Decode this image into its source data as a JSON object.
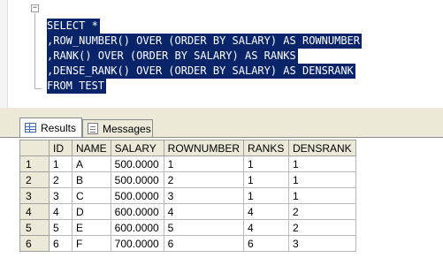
{
  "editor": {
    "lines": [
      "SELECT *",
      ",ROW_NUMBER() OVER (ORDER BY SALARY) AS ROWNUMBER",
      ",RANK() OVER (ORDER BY SALARY) AS RANKS",
      ",DENSE_RANK() OVER (ORDER BY SALARY) AS DENSRANK",
      "FROM TEST"
    ],
    "collapse_glyph": "−",
    "selection_color": "#0a246a"
  },
  "tabs": [
    {
      "label": "Results",
      "icon": "grid-icon",
      "active": true
    },
    {
      "label": "Messages",
      "icon": "message-icon",
      "active": false
    }
  ],
  "grid": {
    "columns": [
      "ID",
      "NAME",
      "SALARY",
      "ROWNUMBER",
      "RANKS",
      "DENSRANK"
    ],
    "row_numbers": [
      "1",
      "2",
      "3",
      "4",
      "5",
      "6"
    ],
    "rows": [
      [
        "1",
        "A",
        "500.0000",
        "1",
        "1",
        "1"
      ],
      [
        "2",
        "B",
        "500.0000",
        "2",
        "1",
        "1"
      ],
      [
        "3",
        "C",
        "500.0000",
        "3",
        "1",
        "1"
      ],
      [
        "4",
        "D",
        "600.0000",
        "4",
        "4",
        "2"
      ],
      [
        "5",
        "E",
        "600.0000",
        "5",
        "4",
        "2"
      ],
      [
        "6",
        "F",
        "700.0000",
        "6",
        "6",
        "3"
      ]
    ]
  }
}
